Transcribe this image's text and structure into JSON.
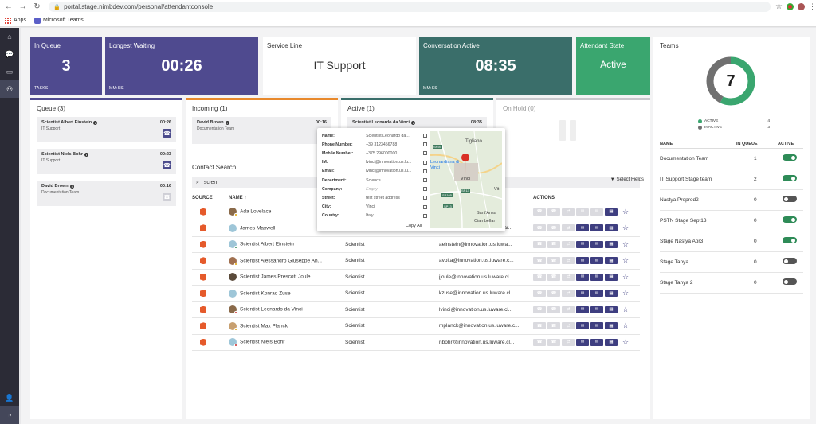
{
  "browser": {
    "url": "portal.stage.nimbdev.com/personal/attendantconsole",
    "bookmarks": [
      "Apps",
      "Microsoft Teams"
    ]
  },
  "tiles": {
    "in_queue": {
      "title": "In Queue",
      "value": "3",
      "sub": "TASKS",
      "color": "#4f4a8f"
    },
    "longest_waiting": {
      "title": "Longest Waiting",
      "value": "00:26",
      "sub": "MM:SS",
      "color": "#4f4a8f"
    },
    "service_line": {
      "title": "Service Line",
      "value": "IT Support"
    },
    "conversation_active": {
      "title": "Conversation Active",
      "value": "08:35",
      "sub": "MM:SS",
      "color": "#3a6e6a"
    },
    "attendant_state": {
      "title": "Attendant State",
      "value": "Active",
      "color": "#3aa66f"
    }
  },
  "queue": {
    "title": "Queue (3)",
    "items": [
      {
        "name": "Scientist Albert Einstein",
        "team": "IT Support",
        "time": "00:26",
        "accept": "active"
      },
      {
        "name": "Scientist Niels Bohr",
        "team": "IT Support",
        "time": "00:23",
        "accept": "active"
      },
      {
        "name": "David Brown",
        "team": "Documentation Team",
        "time": "00:16",
        "accept": "disabled"
      }
    ]
  },
  "incoming": {
    "title": "Incoming (1)",
    "items": [
      {
        "name": "David Brown",
        "team": "Documentation Team",
        "time": "00:16"
      }
    ]
  },
  "active": {
    "title": "Active (1)",
    "items": [
      {
        "name": "Scientist Leonardo da Vinci",
        "time": "08:35"
      }
    ]
  },
  "on_hold": {
    "title": "On Hold (0)"
  },
  "contact_search": {
    "title": "Contact Search",
    "query": "scien",
    "select_fields": "Select Fields",
    "columns": {
      "source": "SOURCE",
      "name": "NAME",
      "actions": "ACTIONS"
    },
    "rows": [
      {
        "name": "Ada Lovelace",
        "dept": "",
        "email": "...uwa...",
        "avatar": "#8a6a4a",
        "presence": "#e0a000",
        "actions": [
          "call",
          "call",
          "call",
          "chat",
          "mail",
          "cal"
        ],
        "enabled": [
          false,
          false,
          false,
          false,
          false,
          true
        ]
      },
      {
        "name": "James Maxwell",
        "dept": "Scientist",
        "email": "jmaxwell@innovation.us.luwar...",
        "avatar": "#9ec6d8",
        "presence": "",
        "enabled": [
          false,
          false,
          false,
          true,
          true,
          true
        ]
      },
      {
        "name": "Scientist Albert Einstein",
        "dept": "Scientist",
        "email": "aeinstein@innovation.us.luwa...",
        "avatar": "#9ec6d8",
        "presence": "#2e8b57",
        "enabled": [
          false,
          false,
          false,
          true,
          true,
          true
        ]
      },
      {
        "name": "Scientist Alessandro Giuseppe An...",
        "dept": "Scientist",
        "email": "avolta@innovation.us.luware.c...",
        "avatar": "#a07050",
        "presence": "#e0a000",
        "enabled": [
          false,
          false,
          false,
          true,
          true,
          true
        ]
      },
      {
        "name": "Scientist James Prescott Joule",
        "dept": "Scientist",
        "email": "jjoule@innovation.us.luware.cl...",
        "avatar": "#5a4a3a",
        "presence": "",
        "enabled": [
          false,
          false,
          false,
          true,
          true,
          true
        ]
      },
      {
        "name": "Scientist Konrad Zuse",
        "dept": "Scientist",
        "email": "kzuse@innovation.us.luware.cl...",
        "avatar": "#9ec6d8",
        "presence": "",
        "enabled": [
          false,
          false,
          false,
          true,
          true,
          true
        ]
      },
      {
        "name": "Scientist Leonardo da Vinci",
        "dept": "Scientist",
        "email": "lvinci@innovation.us.luware.cl...",
        "avatar": "#8a6a4a",
        "presence": "#cc2b2b",
        "enabled": [
          false,
          false,
          false,
          true,
          true,
          true
        ]
      },
      {
        "name": "Scientist Max Planck",
        "dept": "Scientist",
        "email": "mplanck@innovation.us.luware.c...",
        "avatar": "#c8a070",
        "presence": "#e0a000",
        "enabled": [
          false,
          false,
          false,
          true,
          true,
          true
        ]
      },
      {
        "name": "Scientist Niels Bohr",
        "dept": "Scientist",
        "email": "nbohr@innovation.us.luware.cl...",
        "avatar": "#9ec6d8",
        "presence": "#cc2b2b",
        "enabled": [
          false,
          false,
          false,
          true,
          true,
          true
        ]
      }
    ]
  },
  "contact_popup": {
    "fields": [
      {
        "label": "Name:",
        "value": "Scientist Leonardo da..."
      },
      {
        "label": "Phone Number:",
        "value": "+39 3123456788"
      },
      {
        "label": "Mobile Number:",
        "value": "+375 296000000"
      },
      {
        "label": "IM:",
        "value": "lvinci@innovation.us.lu..."
      },
      {
        "label": "Email:",
        "value": "lvinci@innovation.us.lu..."
      },
      {
        "label": "Department:",
        "value": "Science"
      },
      {
        "label": "Company:",
        "value": "Empty"
      },
      {
        "label": "Street:",
        "value": "test street address"
      },
      {
        "label": "City:",
        "value": "Vinci"
      },
      {
        "label": "Country:",
        "value": "Italy"
      }
    ],
    "copy_all": "Copy All",
    "map_labels": {
      "town": "Leonardiana di Vinci",
      "vinci": "Vinci",
      "tigliano": "Tigliano",
      "sp": [
        "SP59",
        "SP13",
        "SP105",
        "SP13"
      ],
      "sant": "Sant'Ansa",
      "ciamb": "Ciambellar",
      "vit": "Vit"
    }
  },
  "teams": {
    "title": "Teams",
    "total": "7",
    "active_count": "4",
    "inactive_count": "3",
    "active_label": "ACTIVE",
    "inactive_label": "INACTIVE",
    "colors": {
      "active": "#3aa66f",
      "inactive": "#707070"
    },
    "columns": {
      "name": "NAME",
      "in_queue": "IN QUEUE",
      "active": "ACTIVE"
    },
    "rows": [
      {
        "name": "Documentation Team",
        "in_queue": "1",
        "active": true
      },
      {
        "name": "IT Support Stage team",
        "in_queue": "2",
        "active": true
      },
      {
        "name": "Nastya Preprod2",
        "in_queue": "0",
        "active": false
      },
      {
        "name": "PSTN Stage Sept13",
        "in_queue": "0",
        "active": true
      },
      {
        "name": "Stage Nastya Apr3",
        "in_queue": "0",
        "active": true
      },
      {
        "name": "Stage Tanya",
        "in_queue": "0",
        "active": false
      },
      {
        "name": "Stage Tanya 2",
        "in_queue": "0",
        "active": false
      }
    ]
  }
}
